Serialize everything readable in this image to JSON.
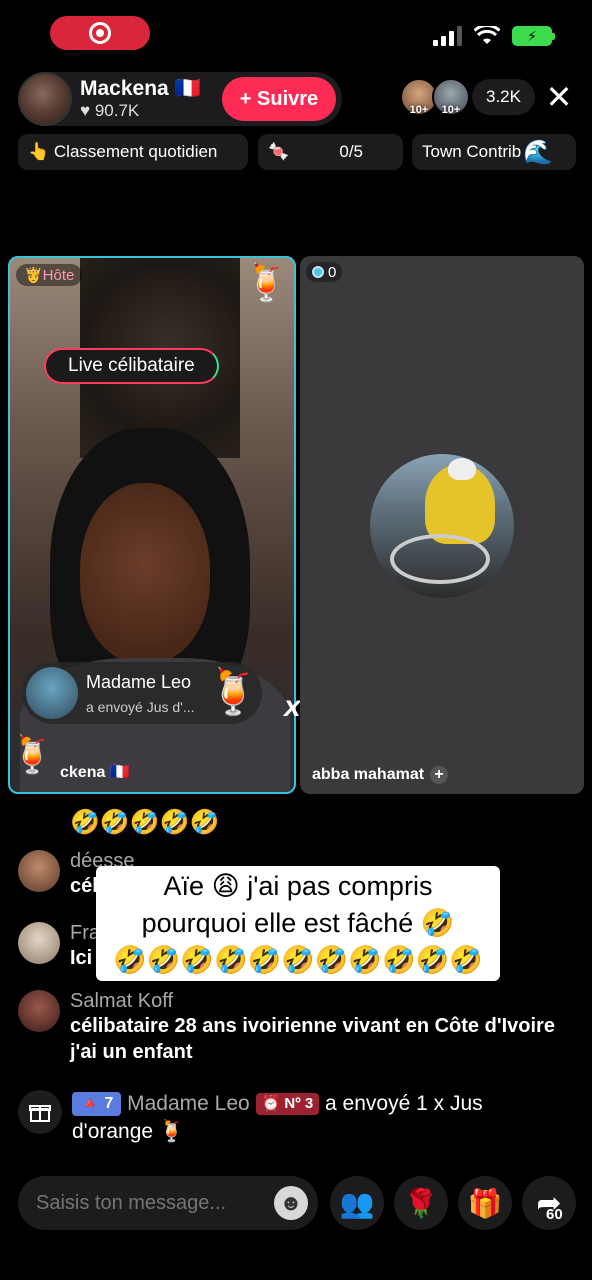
{
  "host": {
    "name": "Mackena 🇫🇷",
    "likes": "♥ 90.7K",
    "follow_label": "+ Suivre"
  },
  "viewers": {
    "badge_a": "10+",
    "badge_b": "10+",
    "count": "3.2K",
    "close_icon": "✕"
  },
  "chips": {
    "ranking": "👆 Classement quotidien",
    "goal_icon": "🍬",
    "goal_progress": "0/5",
    "contrib": "Town Contrib",
    "contrib_icon": "🌊"
  },
  "left_panel": {
    "host_badge": "👸Hôte",
    "live_tag": "Live célibataire",
    "drink_icon": "🍹",
    "gift_sender": "Madame Leo",
    "gift_sub": "a envoyé  Jus d'...",
    "gift_icon": "🍹",
    "name_label": "ckena 🇫🇷",
    "combo": "x1"
  },
  "right_panel": {
    "score": "0",
    "guest_name": "abba mahamat",
    "add_icon": "+"
  },
  "chat": {
    "emoji_line": "🤣🤣🤣🤣🤣",
    "messages": [
      {
        "user": "déesse",
        "text": "célib"
      },
      {
        "user": "Fra",
        "text": "Ici"
      },
      {
        "user": "Salmat Koff",
        "text": "célibataire 28 ans ivoirienne vivant en Côte d'Ivoire j'ai un enfant"
      }
    ],
    "gift_message": {
      "level": "🔺 7",
      "user": "Madame Leo",
      "rank": "⏰ Nº 3",
      "text": " a envoyé 1 x Jus d'orange 🍹"
    }
  },
  "caption": {
    "line1": "Aïe 😩 j'ai pas compris",
    "line2": "pourquoi elle est fâché 🤣",
    "line3": "🤣🤣🤣🤣🤣🤣🤣🤣🤣🤣🤣"
  },
  "bottom": {
    "input_placeholder": "Saisis ton message...",
    "emoji_icon": "☻",
    "collab_icon": "👥",
    "rose_icon": "🌹",
    "gift_icon": "🎁",
    "share_icon": "➦",
    "share_count": "60"
  },
  "colors": {
    "accent": "#fe2c55",
    "panel_border": "#38c3d9",
    "battery": "#3ddc4f"
  }
}
